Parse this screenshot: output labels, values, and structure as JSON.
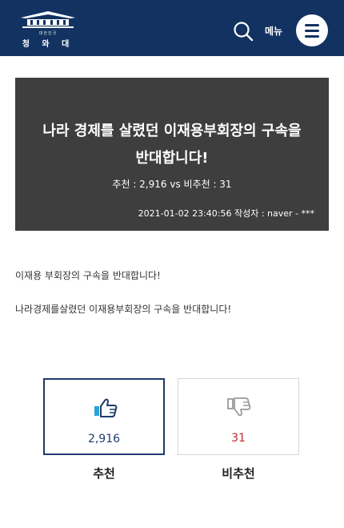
{
  "header": {
    "logo_text": "청 와 대",
    "logo_subtext": "대한민국",
    "menu_label": "메뉴"
  },
  "banner": {
    "title_line1": "나라 경제를 살렸던 이재용부회장의 구속을",
    "title_line2": "반대합니다!",
    "votes": "추천 : 2,916 vs 비추천 : 31",
    "meta": "2021-01-02 23:40:56 작성자 : naver - ***"
  },
  "body": {
    "line1": "이재용 부회장의 구속을 반대합니다!",
    "line2": "나라경제를살렸던 이재용부회장의 구속을 반대합니다!"
  },
  "vote": {
    "up_count": "2,916",
    "up_label": "추천",
    "down_count": "31",
    "down_label": "비추천"
  },
  "colors": {
    "header_bg": "#123261",
    "banner_bg": "#3e3e3e",
    "up_accent": "#1f3c6e",
    "down_accent": "#c0292e"
  },
  "icons": [
    "blue-house-logo",
    "search-icon",
    "hamburger-menu-icon",
    "thumbs-up-icon",
    "thumbs-down-icon"
  ]
}
